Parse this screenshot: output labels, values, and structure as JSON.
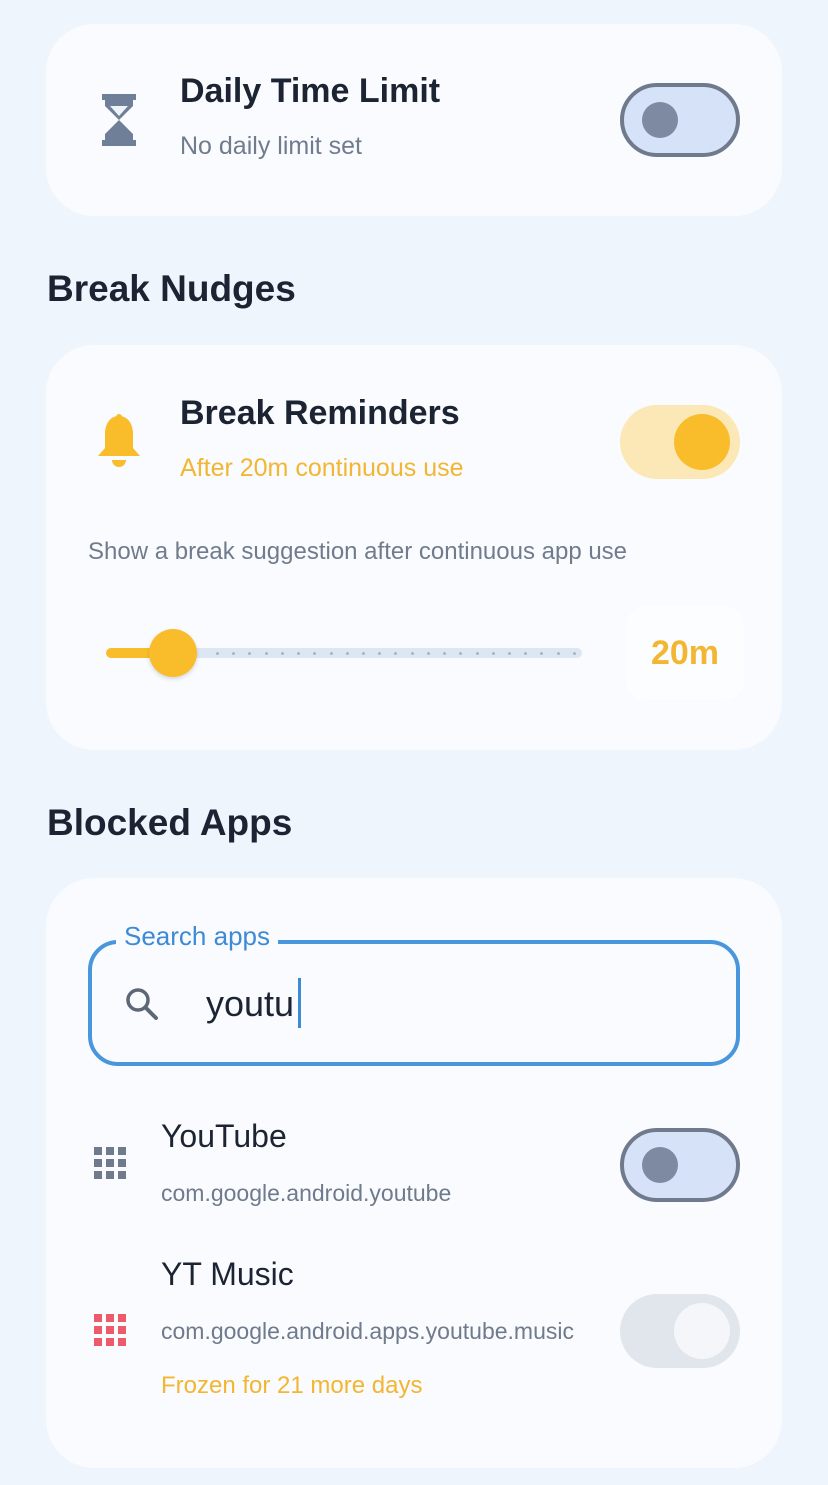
{
  "daily_limit": {
    "icon": "hourglass-icon",
    "title": "Daily Time Limit",
    "subtitle": "No daily limit set",
    "enabled": false
  },
  "break_section": {
    "heading": "Break Nudges",
    "reminders": {
      "icon": "bell-icon",
      "title": "Break Reminders",
      "subtitle": "After 20m continuous use",
      "enabled": true
    },
    "description": "Show a break suggestion after continuous app use",
    "slider": {
      "value_label": "20m",
      "position": 0.14
    },
    "accent_color": "#f9bd2c"
  },
  "blocked_section": {
    "heading": "Blocked Apps",
    "search": {
      "label": "Search apps",
      "value": "youtu",
      "icon": "search-icon"
    },
    "apps": [
      {
        "name": "YouTube",
        "package": "com.google.android.youtube",
        "icon": "app-grid-icon",
        "enabled": false
      },
      {
        "name": "YT Music",
        "package": "com.google.android.apps.youtube.music",
        "icon": "app-grid-icon",
        "status": "Frozen for 21 more days",
        "enabled": true,
        "disabled": true
      }
    ]
  }
}
